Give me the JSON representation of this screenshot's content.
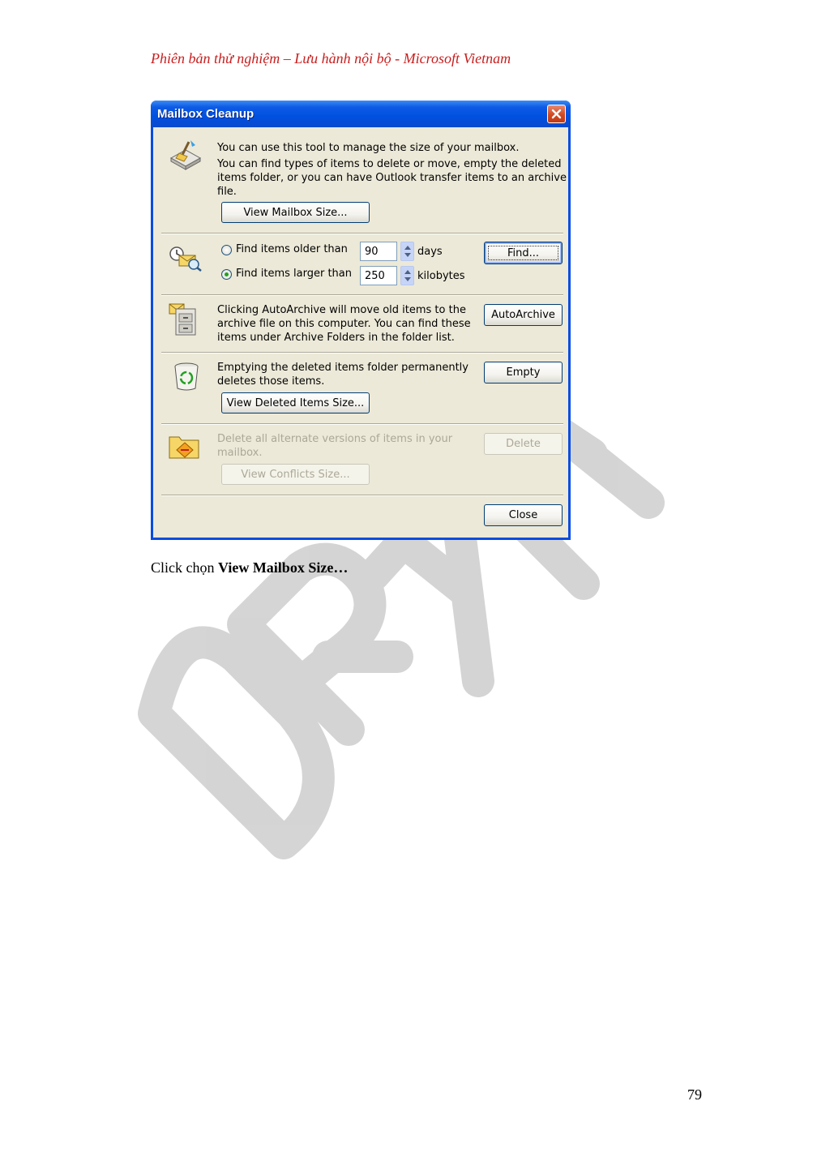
{
  "header": {
    "note": "Phiên bản thử nghiệm – Lưu hành nội bộ - Microsoft Vietnam"
  },
  "watermark": {
    "text": "DRAFT"
  },
  "dialog": {
    "title": "Mailbox Cleanup",
    "intro": {
      "line1": "You can use this tool to manage the size of your mailbox.",
      "line2": "You can find types of items to delete or move, empty the deleted",
      "line3": "items folder, or you can have Outlook transfer items to an archive",
      "line4": "file.",
      "view_mailbox_size_button": "View Mailbox Size..."
    },
    "find": {
      "older_label": "Find items older than",
      "older_value": "90",
      "older_unit": "days",
      "larger_label": "Find items larger than",
      "larger_value": "250",
      "larger_unit": "kilobytes",
      "selected": "larger",
      "find_button": "Find..."
    },
    "autoarchive": {
      "line1": "Clicking AutoArchive will move old items to the",
      "line2": "archive file on this computer. You can find these",
      "line3": "items under Archive Folders in the folder list.",
      "button": "AutoArchive"
    },
    "deleted": {
      "line1": "Emptying the deleted items folder permanently",
      "line2": "deletes those items.",
      "view_button": "View Deleted Items Size...",
      "empty_button": "Empty"
    },
    "conflicts": {
      "line1": "Delete all alternate versions of items in your",
      "line2": "mailbox.",
      "view_button": "View Conflicts Size...",
      "delete_button": "Delete"
    },
    "close_button": "Close",
    "icons": {
      "title_close": "close-icon",
      "intro": "mailbox-broom-icon",
      "find": "find-items-icon",
      "archive": "archive-cabinet-icon",
      "deleted": "recycle-bin-icon",
      "conflicts": "conflict-folder-icon"
    }
  },
  "caption": {
    "prefix": "Click chọn ",
    "bold": "View Mailbox Size…"
  },
  "page_number": "79"
}
